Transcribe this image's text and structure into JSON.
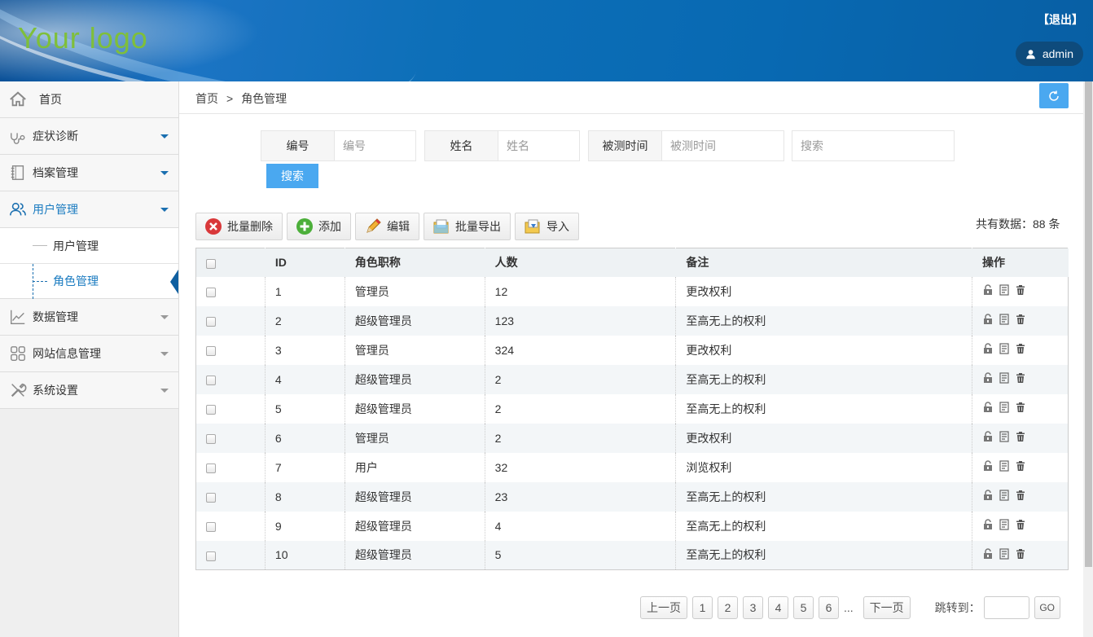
{
  "header": {
    "logo": "Your logo",
    "logout": "【退出】",
    "user": "admin"
  },
  "sidebar": {
    "items": [
      {
        "label": "首页",
        "icon": "home-icon"
      },
      {
        "label": "症状诊断",
        "icon": "stethoscope-icon"
      },
      {
        "label": "档案管理",
        "icon": "notebook-icon"
      },
      {
        "label": "用户管理",
        "icon": "users-icon"
      },
      {
        "label": "数据管理",
        "icon": "line-chart-icon"
      },
      {
        "label": "网站信息管理",
        "icon": "grid-icon"
      },
      {
        "label": "系统设置",
        "icon": "wrench-icon"
      }
    ],
    "subitems": [
      {
        "label": "用户管理"
      },
      {
        "label": "角色管理"
      }
    ]
  },
  "breadcrumb": {
    "home": "首页",
    "separator": ">",
    "current": "角色管理"
  },
  "search": {
    "fields": [
      {
        "label": "编号",
        "placeholder": "编号"
      },
      {
        "label": "姓名",
        "placeholder": "姓名"
      },
      {
        "label": "被测时间",
        "placeholder": "被测时间"
      }
    ],
    "keyword_placeholder": "搜索",
    "button": "搜索"
  },
  "toolbar": {
    "batch_delete": "批量删除",
    "add": "添加",
    "edit": "编辑",
    "batch_export": "批量导出",
    "import": "导入",
    "total": "共有数据：88 条"
  },
  "table": {
    "headers": [
      "ID",
      "角色职称",
      "人数",
      "备注",
      "操作"
    ],
    "rows": [
      [
        "1",
        "管理员",
        "12",
        "更改权利"
      ],
      [
        "2",
        "超级管理员",
        "123",
        "至高无上的权利"
      ],
      [
        "3",
        "管理员",
        "324",
        "更改权利"
      ],
      [
        "4",
        "超级管理员",
        "2",
        "至高无上的权利"
      ],
      [
        "5",
        "超级管理员",
        "2",
        "至高无上的权利"
      ],
      [
        "6",
        "管理员",
        "2",
        "更改权利"
      ],
      [
        "7",
        "用户",
        "32",
        "浏览权利"
      ],
      [
        "8",
        "超级管理员",
        "23",
        "至高无上的权利"
      ],
      [
        "9",
        "超级管理员",
        "4",
        "至高无上的权利"
      ],
      [
        "10",
        "超级管理员",
        "5",
        "至高无上的权利"
      ]
    ]
  },
  "pager": {
    "prev": "上一页",
    "pages": [
      "1",
      "2",
      "3",
      "4",
      "5",
      "6"
    ],
    "ellipsis": "...",
    "next": "下一页",
    "jump_label": "跳转到：",
    "go": "GO"
  },
  "colors": {
    "accent": "#4aa8f0",
    "active_nav": "#1a7bc0",
    "header_blue": "#0869b2",
    "logo_green": "#7fbf3a"
  }
}
